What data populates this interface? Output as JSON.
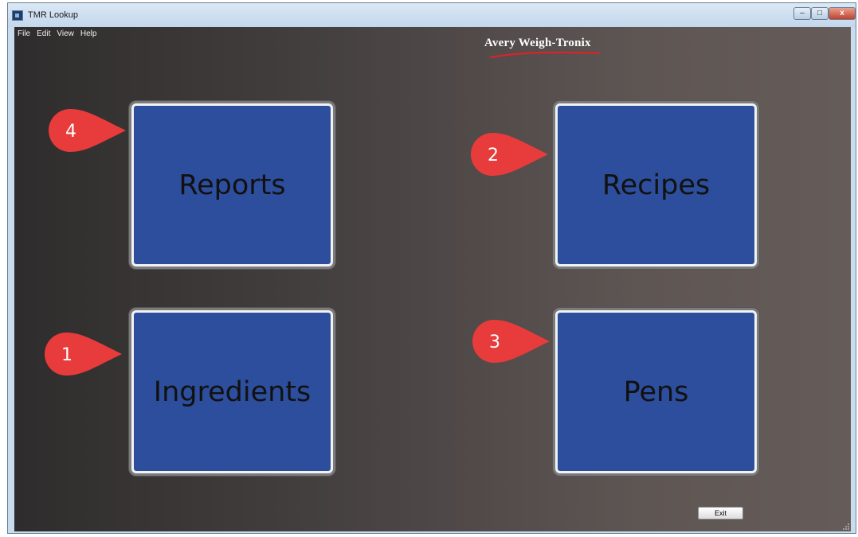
{
  "window": {
    "title": "TMR Lookup",
    "controls": {
      "minimize": "–",
      "maximize": "□",
      "close": "x"
    }
  },
  "menu": [
    "File",
    "Edit",
    "View",
    "Help"
  ],
  "brand": {
    "logo_text": "Avery Weigh-Tronix",
    "swoosh_color": "#d8242a"
  },
  "tiles": {
    "reports": "Reports",
    "recipes": "Recipes",
    "ingredients": "Ingredients",
    "pens": "Pens"
  },
  "callouts": {
    "reports": "4",
    "recipes": "2",
    "ingredients": "1",
    "pens": "3"
  },
  "exit_label": "Exit",
  "colors": {
    "tile_fill": "#2d4e9c",
    "callout_fill": "#e83b3b"
  }
}
